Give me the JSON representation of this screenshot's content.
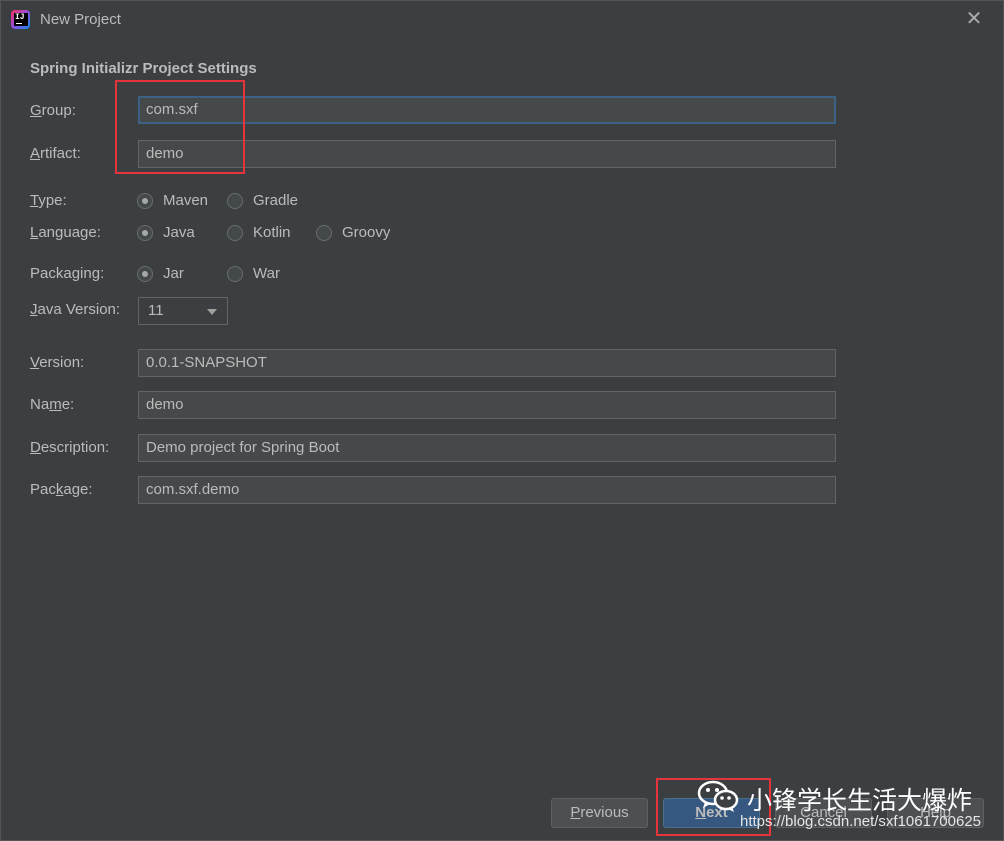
{
  "window": {
    "title": "New Project",
    "close_glyph": "✕"
  },
  "section_title": "Spring Initializr Project Settings",
  "fields": {
    "group": {
      "label_ul": "G",
      "label_rest": "roup:",
      "value": "com.sxf"
    },
    "artifact": {
      "label_ul": "A",
      "label_rest": "rtifact:",
      "value": "demo"
    },
    "version": {
      "label_ul": "V",
      "label_rest": "ersion:",
      "value": "0.0.1-SNAPSHOT"
    },
    "name": {
      "label_pre": "Na",
      "label_ul": "m",
      "label_rest": "e:",
      "value": "demo"
    },
    "description": {
      "label_ul": "D",
      "label_rest": "escription:",
      "value": "Demo project for Spring Boot"
    },
    "package": {
      "label_pre": "Pac",
      "label_ul": "k",
      "label_rest": "age:",
      "value": "com.sxf.demo"
    }
  },
  "type": {
    "label_ul": "T",
    "label_rest": "ype:",
    "options": [
      "Maven",
      "Gradle"
    ],
    "selected": "Maven"
  },
  "language": {
    "label_ul": "L",
    "label_rest": "anguage:",
    "options": [
      "Java",
      "Kotlin",
      "Groovy"
    ],
    "selected": "Java"
  },
  "packaging": {
    "label_pre": "Packa",
    "label_ul": "g",
    "label_rest": "ing:",
    "options": [
      "Jar",
      "War"
    ],
    "selected": "Jar"
  },
  "java_version": {
    "label_ul": "J",
    "label_rest": "ava Version:",
    "value": "11"
  },
  "buttons": {
    "previous": {
      "ul": "P",
      "rest": "revious"
    },
    "next": {
      "ul": "N",
      "rest": "ext"
    },
    "cancel": "Cancel",
    "help": "Help"
  },
  "watermark": {
    "text": "小锋学长生活大爆炸",
    "url": "https://blog.csdn.net/sxf1061700625",
    "icon": "wechat-icon"
  },
  "colors": {
    "background": "#3c3f41",
    "field_bg": "#45494a",
    "focus_border": "#3d6185",
    "default_button": "#365880",
    "highlight_box": "#e7343a"
  }
}
